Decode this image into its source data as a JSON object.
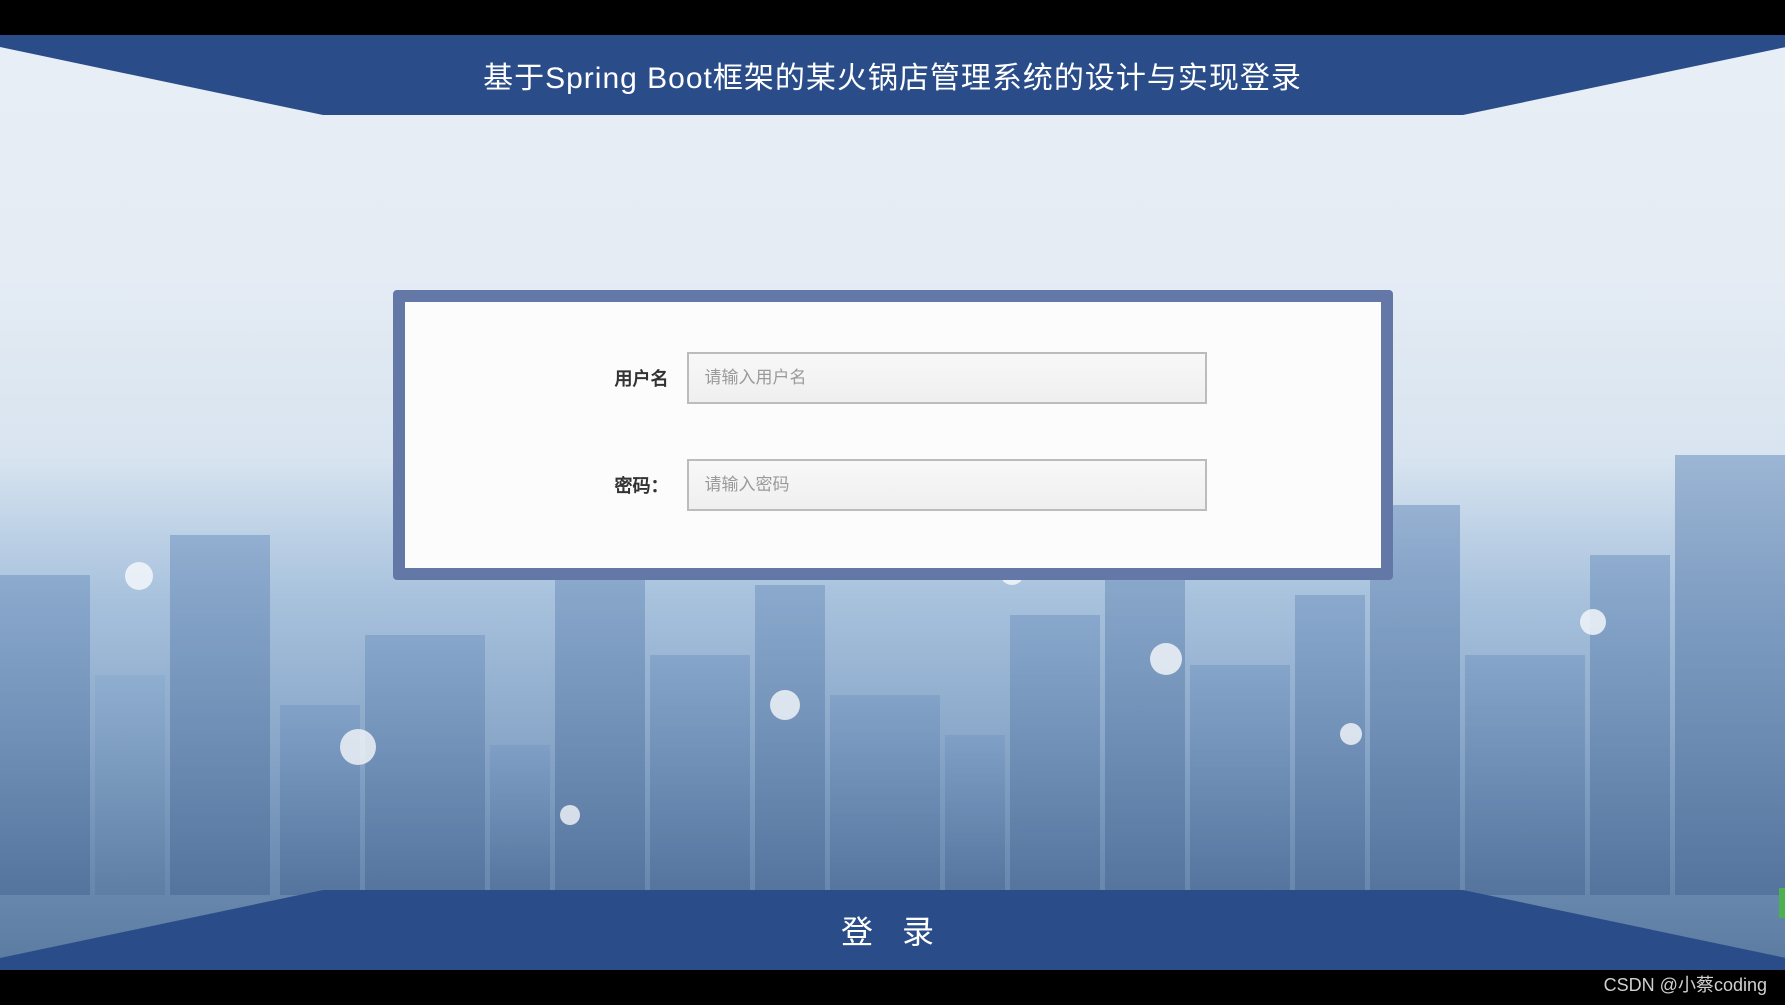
{
  "header": {
    "title": "基于Spring Boot框架的某火锅店管理系统的设计与实现登录"
  },
  "form": {
    "username": {
      "label": "用户名",
      "placeholder": "请输入用户名",
      "value": ""
    },
    "password": {
      "label": "密码：",
      "placeholder": "请输入密码",
      "value": ""
    }
  },
  "footer": {
    "login_button": "登 录"
  },
  "watermark": "CSDN @小蔡coding",
  "colors": {
    "banner": "#2a4d8a",
    "box_border": "#6478a8",
    "input_border": "#bcbcbc"
  }
}
